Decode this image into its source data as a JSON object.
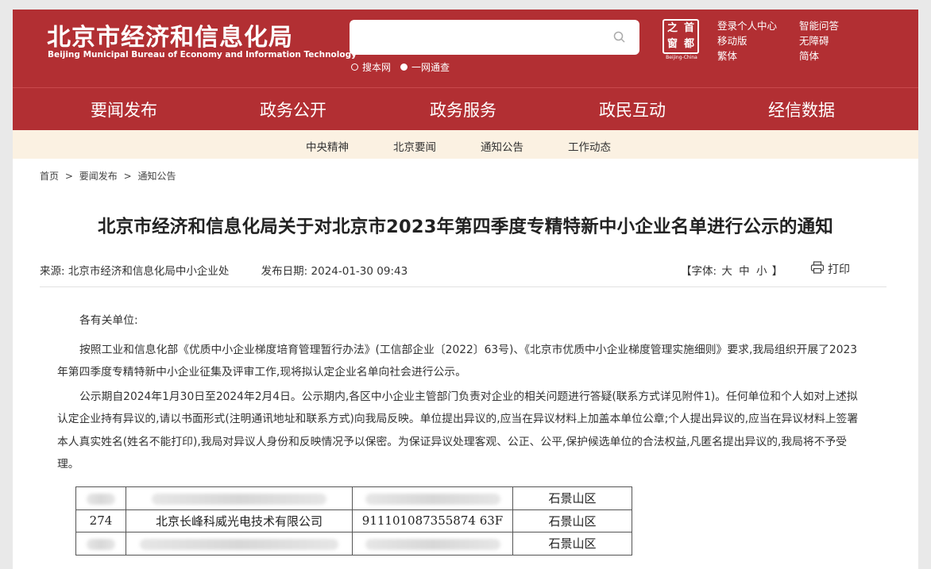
{
  "header": {
    "logo_cn": "北京市经济和信息化局",
    "logo_en": "Beijing Municipal Bureau of Economy and Information Technology",
    "search_placeholder": "",
    "search_options": [
      "搜本网",
      "一网通查"
    ],
    "seal": {
      "chars": [
        "之",
        "首",
        "窗",
        "都"
      ],
      "caption": "Beijing-China"
    },
    "links_col1": [
      "登录个人中心",
      "移动版",
      "繁体"
    ],
    "links_col2": [
      "智能问答",
      "无障碍",
      "简体"
    ]
  },
  "mainnav": [
    "要闻发布",
    "政务公开",
    "政务服务",
    "政民互动",
    "经信数据"
  ],
  "subnav": [
    "中央精神",
    "北京要闻",
    "通知公告",
    "工作动态"
  ],
  "breadcrumb": [
    "首页",
    ">",
    "要闻发布",
    ">",
    "通知公告"
  ],
  "article": {
    "title": "北京市经济和信息化局关于对北京市2023年第四季度专精特新中小企业名单进行公示的通知",
    "source_label": "来源:",
    "source": "北京市经济和信息化局中小企业处",
    "date_label": "发布日期:",
    "date": "2024-01-30 09:43",
    "font_label_open": "【字体:",
    "font_sizes": [
      "大",
      "中",
      "小"
    ],
    "font_label_close": "】",
    "print_label": "打印",
    "salutation": "各有关单位:",
    "paragraphs": [
      "按照工业和信息化部《优质中小企业梯度培育管理暂行办法》(工信部企业〔2022〕63号)、《北京市优质中小企业梯度管理实施细则》要求,我局组织开展了2023年第四季度专精特新中小企业征集及评审工作,现将拟认定企业名单向社会进行公示。",
      "公示期自2024年1月30日至2024年2月4日。公示期内,各区中小企业主管部门负责对企业的相关问题进行答疑(联系方式详见附件1)。任何单位和个人如对上述拟认定企业持有异议的,请以书面形式(注明通讯地址和联系方式)向我局反映。单位提出异议的,应当在异议材料上加盖本单位公章;个人提出异议的,应当在异议材料上签署本人真实姓名(姓名不能打印),我局对异议人身份和反映情况予以保密。为保证异议处理客观、公正、公平,保护候选单位的合法权益,凡匿名提出异议的,我局将不予受理。"
    ],
    "table_rows": [
      {
        "no": "",
        "name": "",
        "code": "",
        "district": "石景山区",
        "blurred": true
      },
      {
        "no": "274",
        "name": "北京长峰科威光电技术有限公司",
        "code": "911101087355874 63F",
        "district": "石景山区",
        "blurred": false
      },
      {
        "no": "",
        "name": "",
        "code": "",
        "district": "石景山区",
        "blurred": true
      }
    ]
  },
  "colors": {
    "brand_red": "#b22f33",
    "subnav_bg": "#fbf1e2",
    "active_underline": "#f1d6a6"
  }
}
